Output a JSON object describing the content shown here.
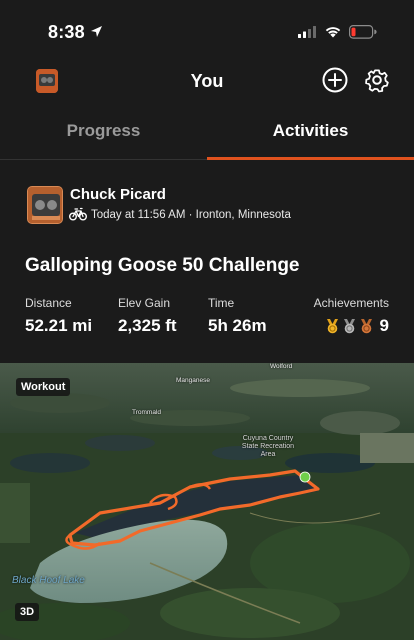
{
  "status_bar": {
    "time": "8:38"
  },
  "nav": {
    "title": "You"
  },
  "tabs": [
    {
      "label": "Progress",
      "active": false
    },
    {
      "label": "Activities",
      "active": true
    }
  ],
  "activity": {
    "athlete_name": "Chuck Picard",
    "meta": "Today at 11:56 AM · Ironton, Minnesota",
    "title": "Galloping Goose 50 Challenge",
    "stats": [
      {
        "label": "Distance",
        "value": "52.21 mi"
      },
      {
        "label": "Elev Gain",
        "value": "2,325 ft"
      },
      {
        "label": "Time",
        "value": "5h 26m"
      }
    ],
    "achievements": {
      "label": "Achievements",
      "count": "9"
    }
  },
  "map": {
    "workout_label": "Workout",
    "view_label": "3D",
    "places": {
      "wolford": "Wolford",
      "manganese": "Manganese",
      "trommald": "Trommald",
      "recreation_area": "Cuyuna Country State Recreation Area",
      "lake": "Black Hoof Lake"
    }
  },
  "colors": {
    "accent": "#e0521e",
    "route": "#f26a2a",
    "background": "#1b1b1b",
    "inactive_tab": "#9a9a9a"
  },
  "icons": [
    "location-arrow-icon",
    "signal-icon",
    "wifi-icon",
    "battery-icon",
    "add-icon",
    "gear-icon",
    "bike-icon",
    "medal-icon"
  ]
}
